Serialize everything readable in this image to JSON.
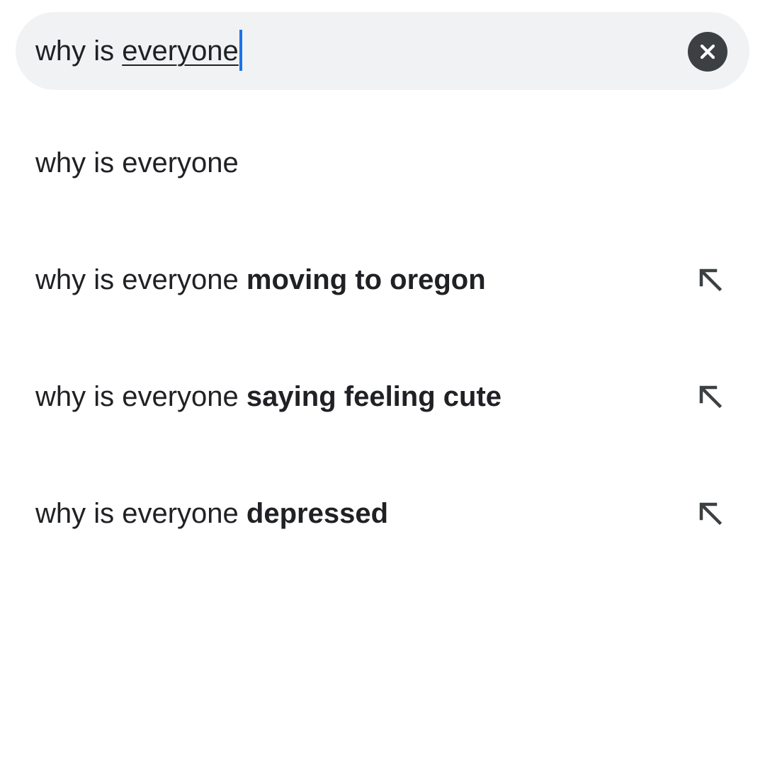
{
  "search": {
    "prefix": "why is ",
    "underlined": "everyone"
  },
  "icons": {
    "clear": "close-circle-icon",
    "fill": "arrow-up-left-icon"
  },
  "colors": {
    "search_bg": "#f0f2f4",
    "caret": "#1a73e8",
    "icon": "#3c4043",
    "text": "#202124"
  },
  "suggestions": [
    {
      "prefix": "why is everyone",
      "bold": ""
    },
    {
      "prefix": "why is everyone ",
      "bold": "moving to oregon"
    },
    {
      "prefix": "why is everyone ",
      "bold": "saying feeling cute"
    },
    {
      "prefix": "why is everyone ",
      "bold": "depressed"
    }
  ]
}
